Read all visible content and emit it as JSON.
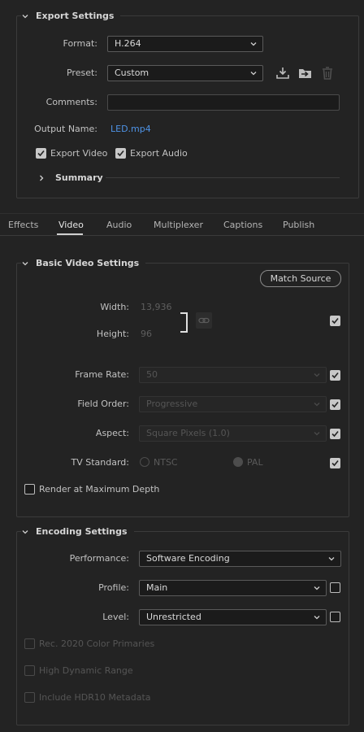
{
  "export_settings": {
    "title": "Export Settings",
    "format_label": "Format:",
    "format_value": "H.264",
    "preset_label": "Preset:",
    "preset_value": "Custom",
    "comments_label": "Comments:",
    "comments_value": "",
    "output_name_label": "Output Name:",
    "output_name_value": "LED.mp4",
    "export_video_label": "Export Video",
    "export_video_checked": true,
    "export_audio_label": "Export Audio",
    "export_audio_checked": true,
    "summary_label": "Summary"
  },
  "tabs": [
    "Effects",
    "Video",
    "Audio",
    "Multiplexer",
    "Captions",
    "Publish"
  ],
  "active_tab": "Video",
  "basic_video": {
    "title": "Basic Video Settings",
    "match_source_label": "Match Source",
    "width_label": "Width:",
    "width_value": "13,936",
    "height_label": "Height:",
    "height_value": "96",
    "frame_rate_label": "Frame Rate:",
    "frame_rate_value": "50",
    "field_order_label": "Field Order:",
    "field_order_value": "Progressive",
    "aspect_label": "Aspect:",
    "aspect_value": "Square Pixels (1.0)",
    "tv_standard_label": "TV Standard:",
    "ntsc_label": "NTSC",
    "pal_label": "PAL",
    "render_max_depth_label": "Render at Maximum Depth"
  },
  "encoding": {
    "title": "Encoding Settings",
    "performance_label": "Performance:",
    "performance_value": "Software Encoding",
    "profile_label": "Profile:",
    "profile_value": "Main",
    "level_label": "Level:",
    "level_value": "Unrestricted",
    "rec2020_label": "Rec. 2020 Color Primaries",
    "hdr_label": "High Dynamic Range",
    "hdr10_label": "Include HDR10 Metadata"
  },
  "colors": {
    "background": "#232323",
    "link": "#4e93e6",
    "active_tab_underline": "#d0d0d0"
  }
}
